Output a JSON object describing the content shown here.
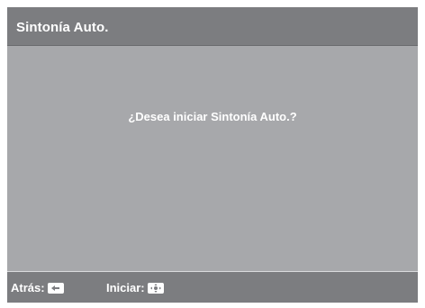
{
  "dialog": {
    "title": "Sintonía Auto.",
    "message": "¿Desea iniciar Sintonía Auto.?"
  },
  "footer": {
    "back_label": "Atrás:",
    "back_key_icon": "return-arrow-icon",
    "start_label": "Iniciar:",
    "start_key_icon": "dpad-center-icon"
  },
  "colors": {
    "background": "#a7a8ab",
    "bar": "#7c7d80",
    "text": "#ffffff"
  }
}
